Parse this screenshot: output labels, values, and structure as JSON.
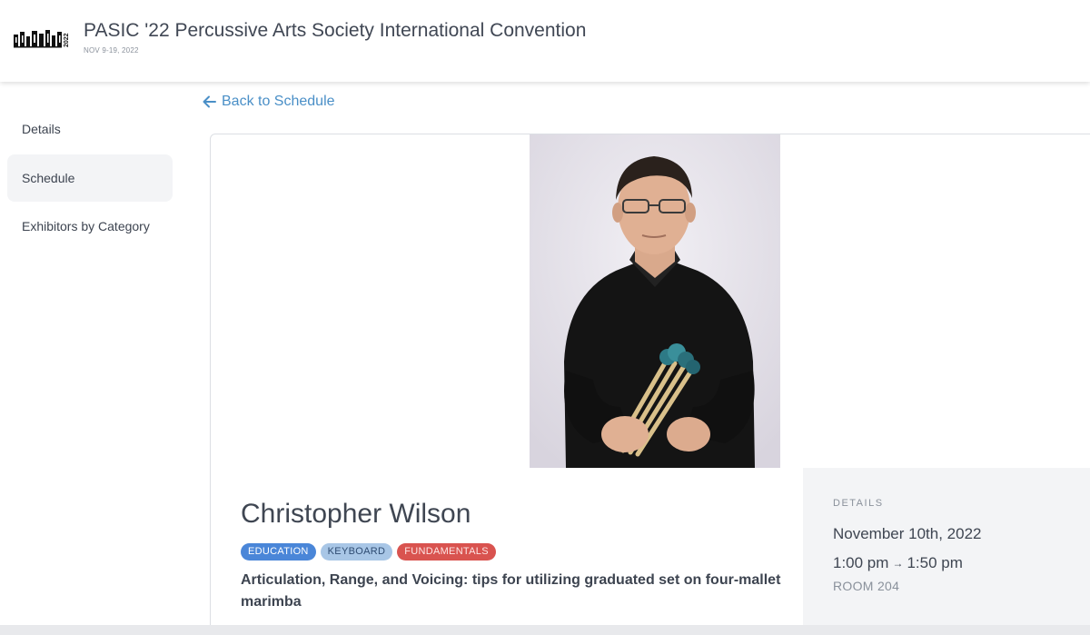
{
  "header": {
    "logo_text": "PASIC 2022",
    "title": "PASIC '22 Percussive Arts Society International Convention",
    "dates": "NOV 9-19, 2022"
  },
  "sidebar": {
    "items": [
      {
        "label": "Details",
        "active": false
      },
      {
        "label": "Schedule",
        "active": true
      },
      {
        "label": "Exhibitors by Category",
        "active": false
      }
    ]
  },
  "back_link": {
    "icon": "arrow-left-icon",
    "label": "Back to Schedule"
  },
  "session": {
    "speaker": "Christopher Wilson",
    "tags": [
      "EDUCATION",
      "KEYBOARD",
      "FUNDAMENTALS"
    ],
    "title": "Articulation, Range, and Voicing: tips for utilizing graduated set on four-mallet marimba"
  },
  "details": {
    "heading": "DETAILS",
    "date": "November 10th, 2022",
    "start_time": "1:00 pm",
    "end_time": "1:50 pm",
    "room": "ROOM 204"
  },
  "colors": {
    "accent_link": "#4a8fc7",
    "tag_education": "#4a86d8",
    "tag_keyboard": "#a8c6e6",
    "tag_fundamentals": "#d9534f"
  }
}
